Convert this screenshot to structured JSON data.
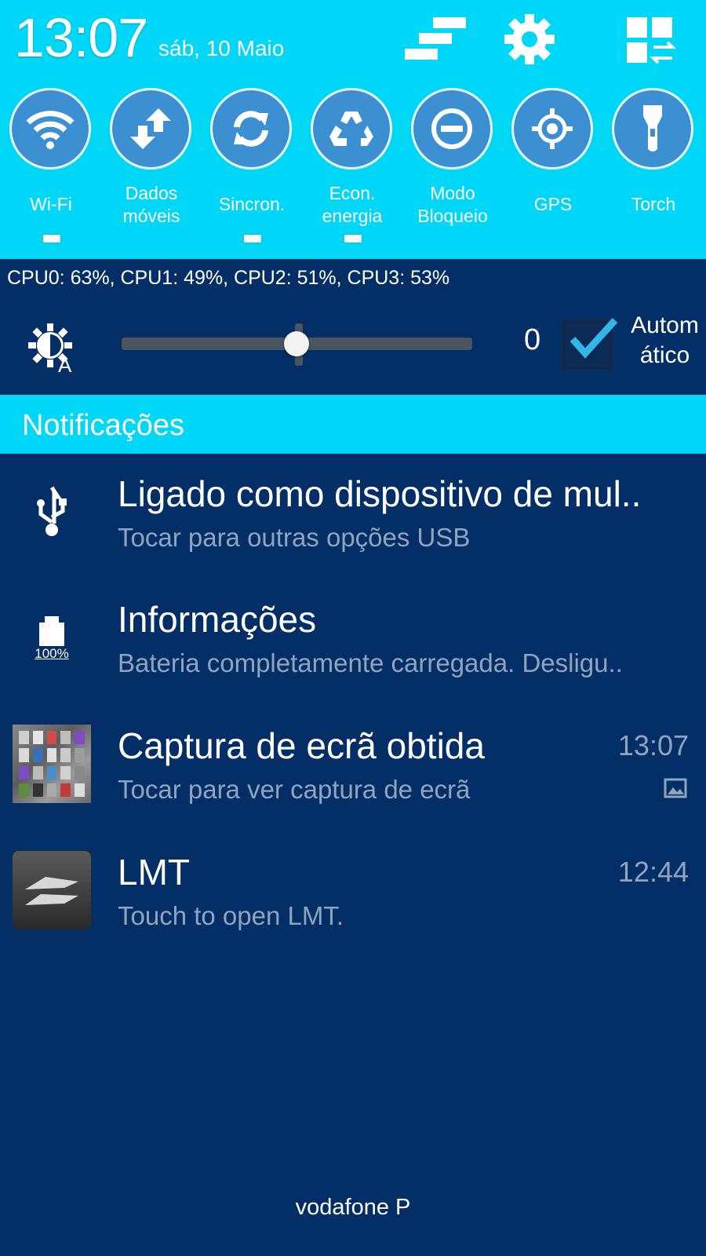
{
  "status": {
    "time": "13:07",
    "date": "sáb, 10 Maio"
  },
  "header_icons": [
    "edit-order-icon",
    "settings-icon",
    "quick-settings-grid-icon"
  ],
  "toggles": [
    {
      "label": "Wi-Fi",
      "icon": "wifi-icon",
      "active": true
    },
    {
      "label": "Dados móveis",
      "icon": "mobile-data-icon",
      "active": false
    },
    {
      "label": "Sincron.",
      "icon": "sync-icon",
      "active": true
    },
    {
      "label": "Econ. energia",
      "icon": "power-saving-icon",
      "active": true
    },
    {
      "label": "Modo Bloqueio",
      "icon": "blocking-mode-icon",
      "active": false
    },
    {
      "label": "GPS",
      "icon": "gps-icon",
      "active": false
    },
    {
      "label": "Torch",
      "icon": "torch-icon",
      "active": false
    }
  ],
  "cpu_text": "CPU0: 63%, CPU1: 49%, CPU2: 51%, CPU3: 53%",
  "brightness": {
    "value": "0",
    "level_fraction": 0.49,
    "auto_checked": true,
    "auto_label_line1": "Autom",
    "auto_label_line2": "ático"
  },
  "notifications_title": "Notificações",
  "notifications": [
    {
      "title": "Ligado como dispositivo de mul..",
      "text": "Tocar para outras opções USB",
      "time": "",
      "icon": "usb-icon"
    },
    {
      "title": "Informações",
      "text": "Bateria completamente carregada. Desligu..",
      "time": "",
      "icon": "battery-icon",
      "icon_text": "100%"
    },
    {
      "title": "Captura de ecrã obtida",
      "text": "Tocar para ver captura de ecrã",
      "time": "13:07",
      "icon": "screenshot-thumbnail",
      "sub_icon": "image-icon"
    },
    {
      "title": "LMT",
      "text": "Touch to open LMT.",
      "time": "12:44",
      "icon": "lmt-app-icon"
    }
  ],
  "carrier": "vodafone P",
  "colors": {
    "header": "#00d6f5",
    "panel": "#042f66",
    "toggle_circle": "#3c8fd0",
    "checkmark": "#33b5e5",
    "secondary_text": "#8ea4bf"
  }
}
